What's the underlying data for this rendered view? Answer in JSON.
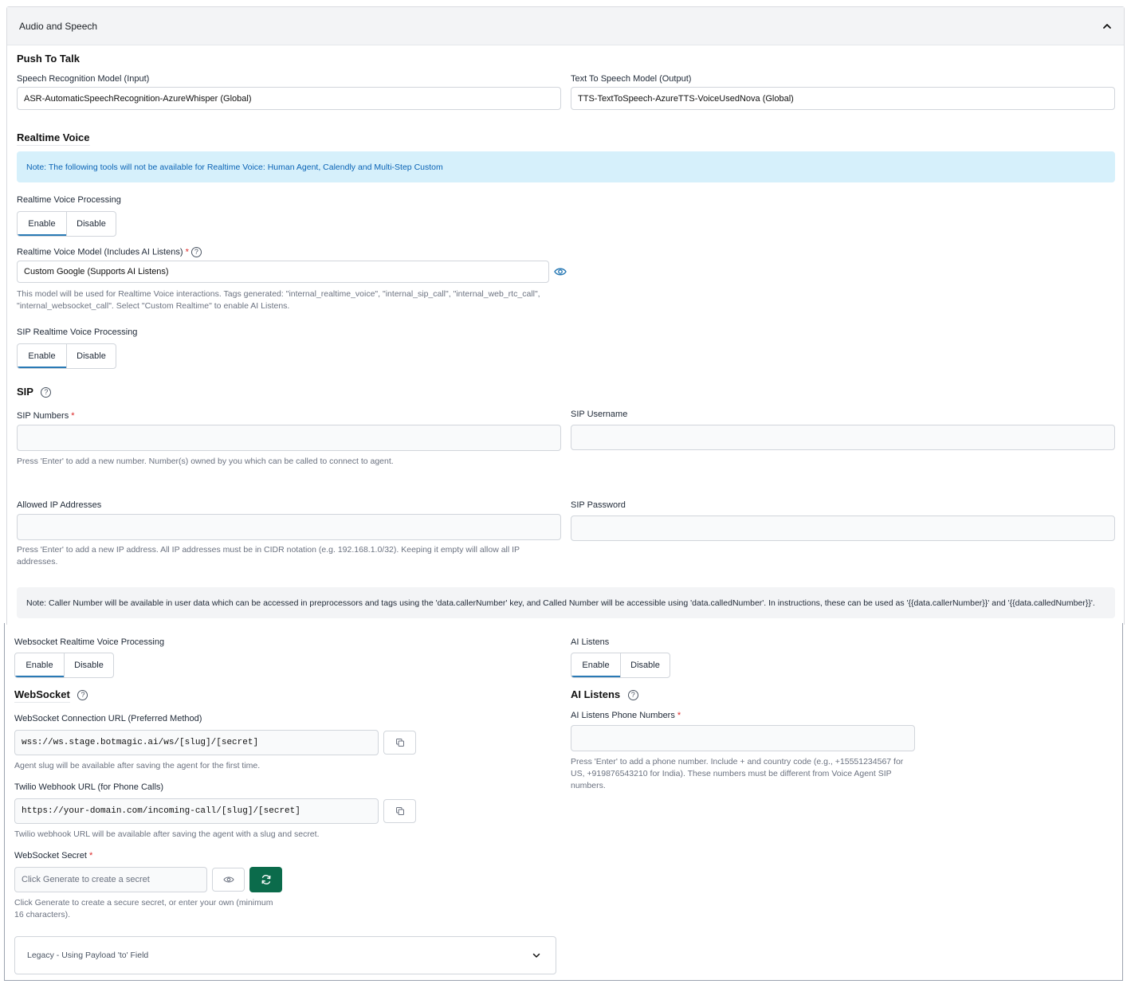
{
  "panel": {
    "title": "Audio and Speech"
  },
  "push_to_talk": {
    "heading": "Push To Talk",
    "asr_label": "Speech Recognition Model (Input)",
    "asr_value": "ASR-AutomaticSpeechRecognition-AzureWhisper (Global)",
    "tts_label": "Text To Speech Model (Output)",
    "tts_value": "TTS-TextToSpeech-AzureTTS-VoiceUsedNova (Global)"
  },
  "realtime_voice": {
    "heading": "Realtime Voice",
    "note": "Note: The following tools will not be available for Realtime Voice: Human Agent, Calendly and Multi-Step Custom",
    "processing_label": "Realtime Voice Processing",
    "model_label": "Realtime Voice Model (Includes AI Listens)",
    "required_mark": "*",
    "model_value": "Custom Google (Supports AI Listens)",
    "model_help_line1": "This model will be used for Realtime Voice interactions. Tags generated: \"internal_realtime_voice\", \"internal_sip_call\", \"internal_web_rtc_call\",",
    "model_help_line2": "\"internal_websocket_call\". Select \"Custom Realtime\" to enable AI Listens.",
    "sip_processing_label": "SIP Realtime Voice Processing"
  },
  "toggle": {
    "enable": "Enable",
    "disable": "Disable"
  },
  "sip": {
    "heading": "SIP",
    "numbers_label": "SIP Numbers",
    "numbers_help": "Press 'Enter' to add a new number. Number(s) owned by you which can be called to connect to agent.",
    "username_label": "SIP Username",
    "allowed_ip_label": "Allowed IP Addresses",
    "allowed_ip_help_line1": "Press 'Enter' to add a new IP address. All IP addresses must be in CIDR notation (e.g. 192.168.1.0/32). Keeping it empty will allow all IP",
    "allowed_ip_help_line2": "addresses.",
    "password_label": "SIP Password",
    "caller_note": "Note: Caller Number will be available in user data which can be accessed in preprocessors and tags using the 'data.callerNumber' key, and Called Number will be accessible using 'data.calledNumber'. In instructions, these can be used as '{{data.callerNumber}}' and '{{data.calledNumber}}'."
  },
  "websocket": {
    "processing_label": "Websocket Realtime Voice Processing",
    "heading": "WebSocket",
    "url_label": "WebSocket Connection URL (Preferred Method)",
    "url_value": "wss://ws.stage.botmagic.ai/ws/[slug]/[secret]",
    "url_help": "Agent slug will be available after saving the agent for the first time.",
    "twilio_label": "Twilio Webhook URL (for Phone Calls)",
    "twilio_value": "https://your-domain.com/incoming-call/[slug]/[secret]",
    "twilio_help": "Twilio webhook URL will be available after saving the agent with a slug and secret.",
    "secret_label": "WebSocket Secret",
    "secret_placeholder": "Click Generate to create a secret",
    "secret_help_line1": "Click Generate to create a secure secret, or enter your own (minimum",
    "secret_help_line2": "16 characters).",
    "legacy_label": "Legacy - Using Payload 'to' Field"
  },
  "ai_listens": {
    "toggle_label": "AI Listens",
    "heading": "AI Listens",
    "phone_label": "AI Listens Phone Numbers",
    "phone_help_line1": "Press 'Enter' to add a phone number. Include + and country code (e.g., +15551234567 for",
    "phone_help_line2": "US, +919876543210 for India). These numbers must be different from Voice Agent SIP",
    "phone_help_line3": "numbers."
  },
  "icons": {
    "collapse": "chevron-up-icon",
    "expand": "chevron-down-icon",
    "help": "question-circle-icon",
    "visibility": "eye-icon",
    "copy": "copy-icon",
    "regenerate": "refresh-icon"
  },
  "colors": {
    "accent": "#2a7ab5",
    "generate_button": "#0b6b4b",
    "info_note_bg": "#d6f0fb",
    "info_note_text": "#0a63b5",
    "required": "#dc2626"
  }
}
